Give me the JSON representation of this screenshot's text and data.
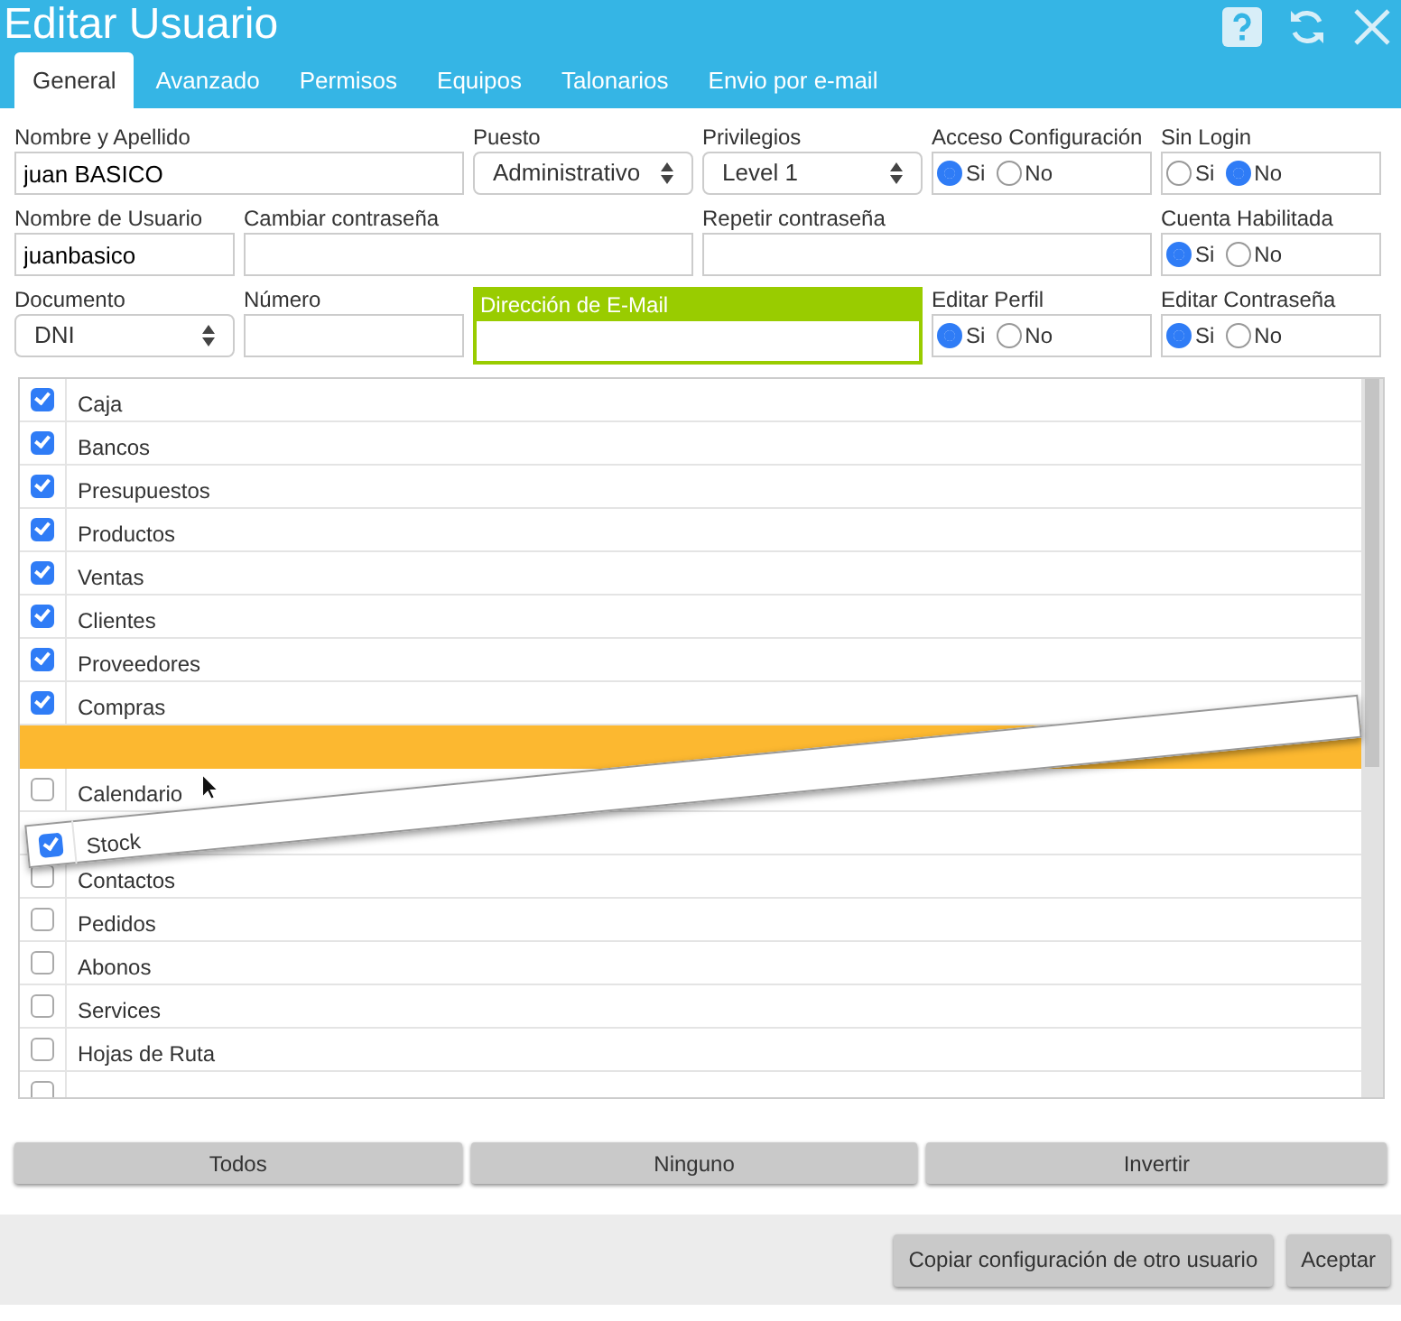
{
  "window": {
    "title": "Editar Usuario"
  },
  "tabs": [
    {
      "label": "General",
      "selected": true
    },
    {
      "label": "Avanzado",
      "selected": false
    },
    {
      "label": "Permisos",
      "selected": false
    },
    {
      "label": "Equipos",
      "selected": false
    },
    {
      "label": "Talonarios",
      "selected": false
    },
    {
      "label": "Envio por e-mail",
      "selected": false
    }
  ],
  "form_rows": [
    [
      {
        "kind": "text",
        "label": "Nombre y Apellido",
        "value": "juan BASICO"
      },
      {
        "kind": "select",
        "label": "Puesto",
        "value": "Administrativo"
      },
      {
        "kind": "select",
        "label": "Privilegios",
        "value": "Level 1"
      },
      {
        "kind": "radio",
        "label": "Acceso Configuración",
        "options": [
          {
            "label": "Si",
            "selected": true
          },
          {
            "label": "No",
            "selected": false
          }
        ]
      },
      {
        "kind": "radio",
        "label": "Sin Login",
        "options": [
          {
            "label": "Si",
            "selected": false
          },
          {
            "label": "No",
            "selected": true
          }
        ]
      }
    ],
    [
      {
        "kind": "text",
        "label": "Nombre de Usuario",
        "value": "juanbasico"
      },
      {
        "kind": "text",
        "label": "Cambiar contraseña"
      },
      {
        "kind": "text",
        "label": "Repetir contraseña"
      },
      {
        "kind": "radio",
        "label": "Cuenta Habilitada",
        "options": [
          {
            "label": "Si",
            "selected": true
          },
          {
            "label": "No",
            "selected": false
          }
        ]
      }
    ],
    [
      {
        "kind": "select",
        "label": "Documento",
        "value": "DNI"
      },
      {
        "kind": "text",
        "label": "Número"
      },
      {
        "kind": "text",
        "label": "Dirección de E-Mail",
        "focused": true
      },
      {
        "kind": "radio",
        "label": "Editar Perfil",
        "options": [
          {
            "label": "Si",
            "selected": true
          },
          {
            "label": "No",
            "selected": false
          }
        ]
      },
      {
        "kind": "radio",
        "label": "Editar Contraseña",
        "options": [
          {
            "label": "Si",
            "selected": true
          },
          {
            "label": "No",
            "selected": false
          }
        ]
      }
    ]
  ],
  "modules": [
    {
      "kind": "item",
      "label": "Caja",
      "checked": true
    },
    {
      "kind": "item",
      "label": "Bancos",
      "checked": true
    },
    {
      "kind": "item",
      "label": "Presupuestos",
      "checked": true
    },
    {
      "kind": "item",
      "label": "Productos",
      "checked": true
    },
    {
      "kind": "item",
      "label": "Ventas",
      "checked": true
    },
    {
      "kind": "item",
      "label": "Clientes",
      "checked": true
    },
    {
      "kind": "item",
      "label": "Proveedores",
      "checked": true
    },
    {
      "kind": "item",
      "label": "Compras",
      "checked": true
    },
    {
      "kind": "drop_target"
    },
    {
      "kind": "item",
      "label": "Calendario",
      "checked": false
    },
    {
      "kind": "covered"
    },
    {
      "kind": "item",
      "label": "Contactos",
      "checked": false
    },
    {
      "kind": "item",
      "label": "Pedidos",
      "checked": false
    },
    {
      "kind": "item",
      "label": "Abonos",
      "checked": false
    },
    {
      "kind": "item",
      "label": "Services",
      "checked": false
    },
    {
      "kind": "item",
      "label": "Hojas de Ruta",
      "checked": false
    },
    {
      "kind": "item",
      "checked": false
    }
  ],
  "dragged_item": {
    "label": "Stock",
    "checked": true
  },
  "selection_buttons": [
    "Todos",
    "Ninguno",
    "Invertir"
  ],
  "footer_buttons": [
    "Copiar configuración de otro usuario",
    "Aceptar"
  ]
}
